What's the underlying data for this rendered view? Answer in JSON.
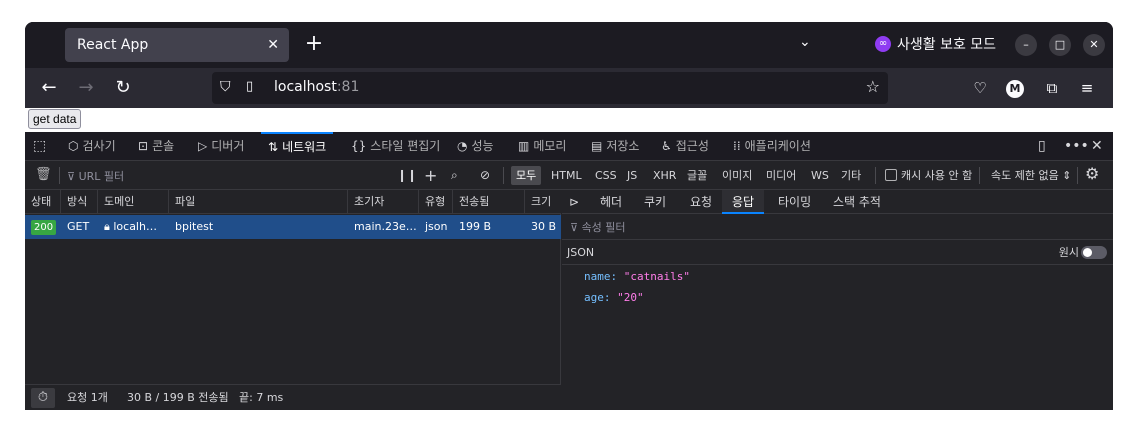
{
  "browser": {
    "tab_title": "React App",
    "private_label": "사생활 보호 모드",
    "url_host": "localhost",
    "url_port": ":81"
  },
  "page": {
    "get_data_button": "get data"
  },
  "devtools": {
    "tabs": [
      {
        "label": "검사기"
      },
      {
        "label": "콘솔"
      },
      {
        "label": "디버거"
      },
      {
        "label": "네트워크"
      },
      {
        "label": "스타일 편집기"
      },
      {
        "label": "성능"
      },
      {
        "label": "메모리"
      },
      {
        "label": "저장소"
      },
      {
        "label": "접근성"
      },
      {
        "label": "애플리케이션"
      }
    ],
    "active_tab": "네트워크",
    "url_filter_placeholder": "URL 필터",
    "type_filters": [
      "모두",
      "HTML",
      "CSS",
      "JS",
      "XHR",
      "글꼴",
      "이미지",
      "미디어",
      "WS",
      "기타"
    ],
    "active_type_filter": "모두",
    "disable_cache_label": "캐시 사용 안 함",
    "throttle_label": "속도 제한 없음 ⇕",
    "columns": [
      "상태",
      "방식",
      "도메인",
      "파일",
      "초기자",
      "유형",
      "전송됨",
      "크기"
    ],
    "request": {
      "status": "200",
      "method": "GET",
      "domain": "localh…",
      "file": "bpitest",
      "initiator": "main.23e…",
      "type": "json",
      "transferred": "199 B",
      "size": "30 B"
    },
    "status_bar": {
      "requests": "요청 1개",
      "transferred": "30 B / 199 B 전송됨",
      "finish": "끝: 7 ms"
    },
    "response_tabs": [
      "헤더",
      "쿠키",
      "요청",
      "응답",
      "타이밍",
      "스택 추적"
    ],
    "active_response_tab": "응답",
    "property_filter_placeholder": "속성 필터",
    "json_label": "JSON",
    "raw_label": "원시",
    "json": [
      {
        "key": "name",
        "value": "\"catnails\""
      },
      {
        "key": "age",
        "value": "\"20\""
      }
    ]
  }
}
